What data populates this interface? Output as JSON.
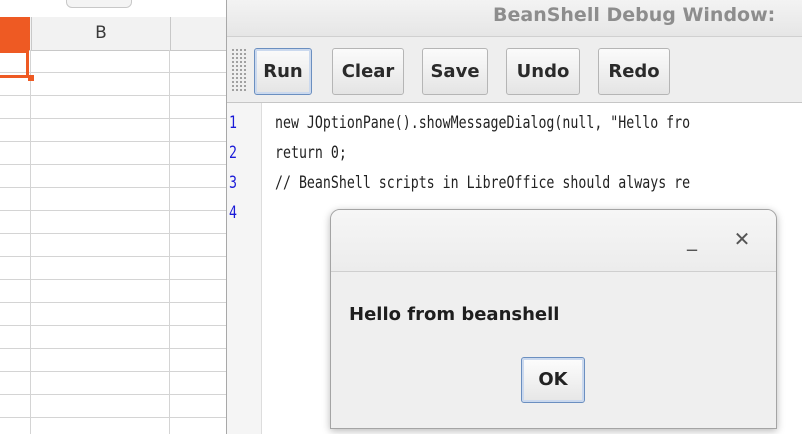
{
  "spreadsheet": {
    "column_b_header": "B",
    "accent_color": "#ee5a23"
  },
  "bsh_window": {
    "title": "BeanShell Debug Window:",
    "toolbar": {
      "run_label": "Run",
      "clear_label": "Clear",
      "save_label": "Save",
      "undo_label": "Undo",
      "redo_label": "Redo"
    },
    "editor": {
      "line_numbers": [
        "1",
        "2",
        "3",
        "4"
      ],
      "lines": [
        "new JOptionPane().showMessageDialog(null, \"Hello fro",
        "return 0;",
        "// BeanShell scripts in LibreOffice should always re",
        ""
      ],
      "line_number_color": "#1a1ad8"
    }
  },
  "dialog": {
    "minimize_icon": "_",
    "close_icon": "✕",
    "message": "Hello from beanshell",
    "ok_label": "OK"
  }
}
